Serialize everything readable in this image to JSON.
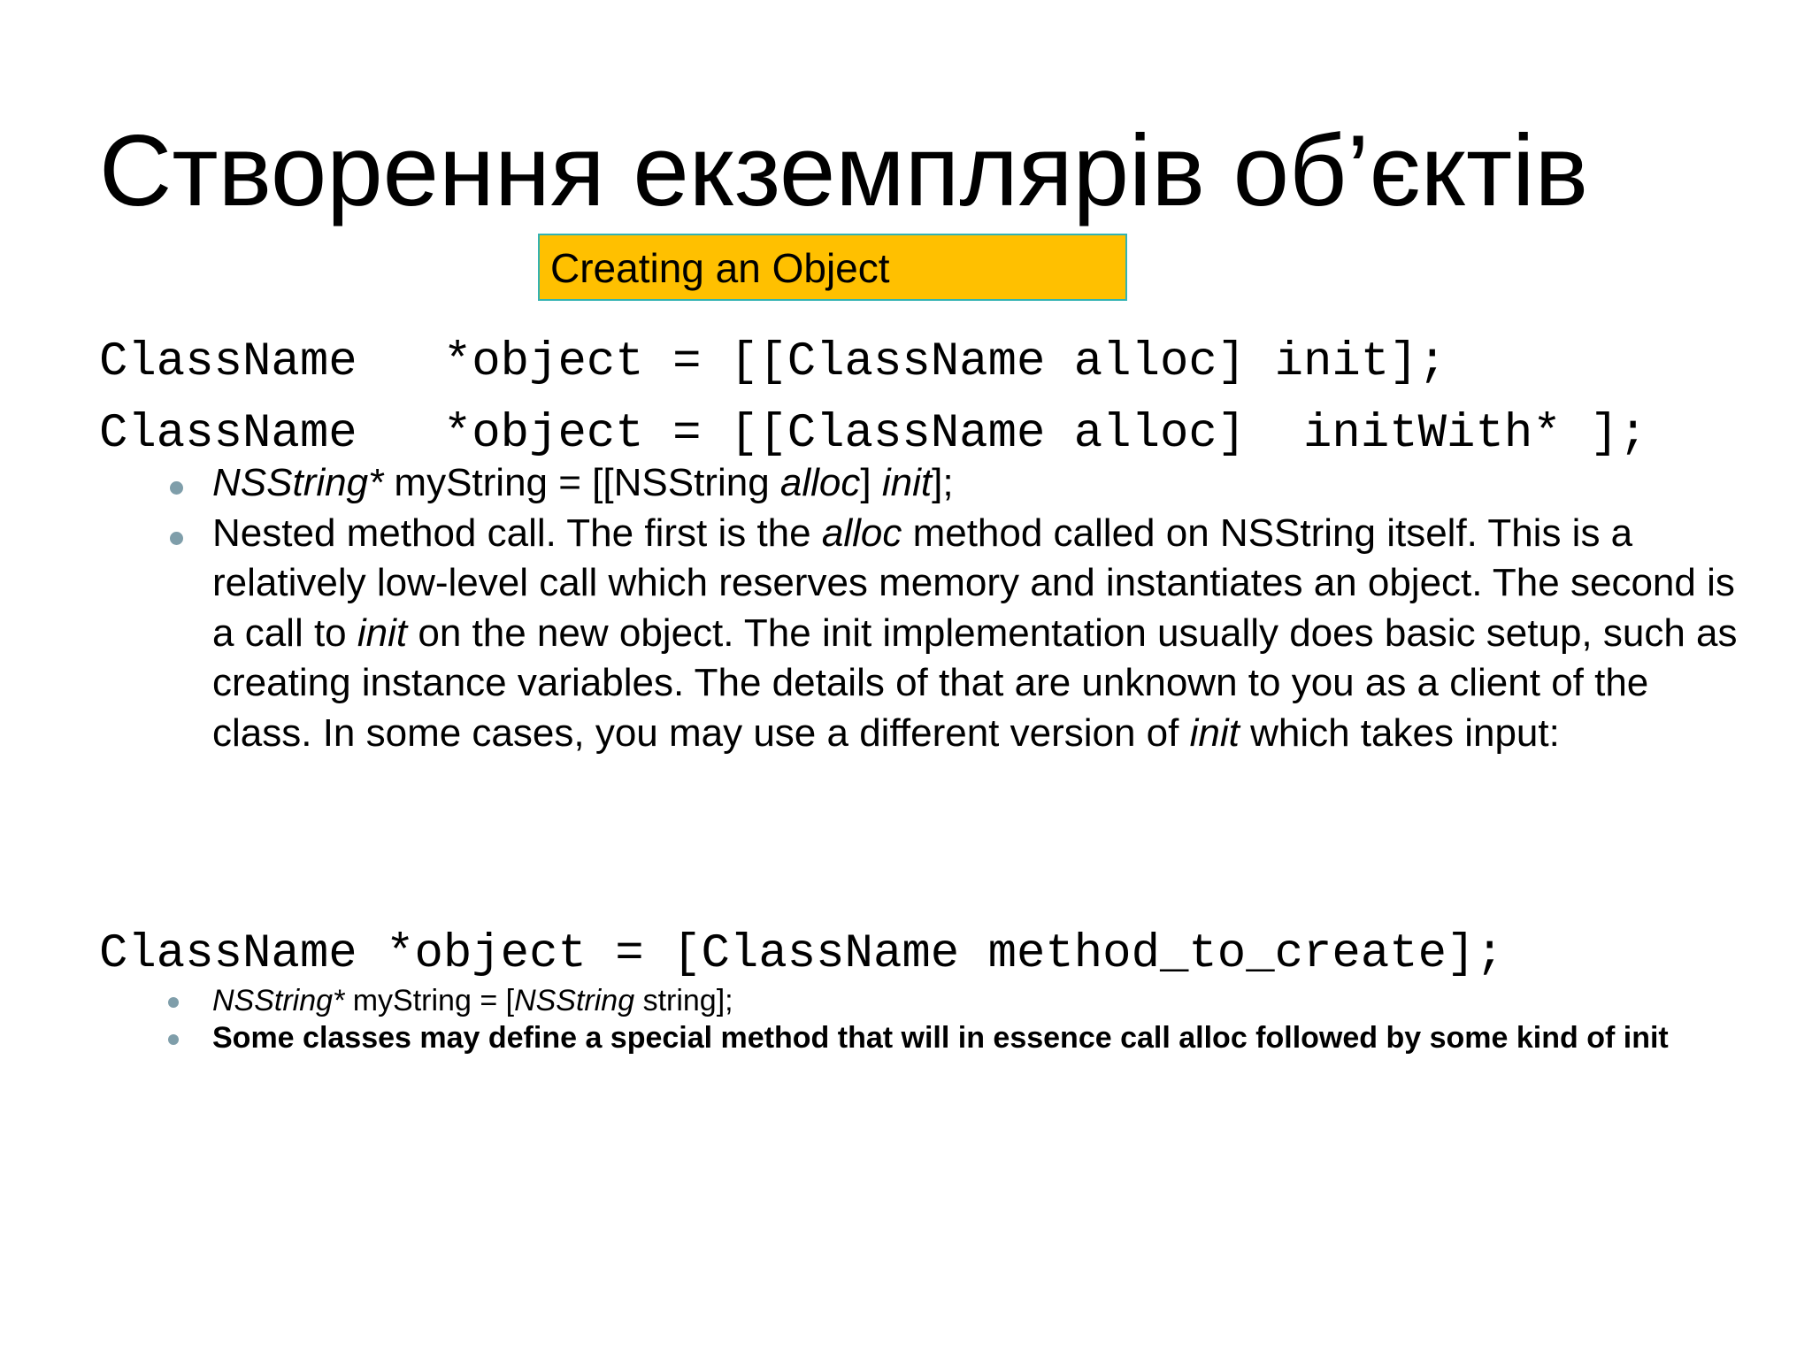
{
  "slide": {
    "title": "Створення екземплярів об’єктів",
    "highlight_label": "Creating an Object"
  },
  "code": {
    "line1": "ClassName   *object = [[ClassName alloc] init];",
    "line2": "ClassName   *object = [[ClassName alloc]  initWith* ];",
    "line3": "ClassName *object = [ClassName method_to_create];"
  },
  "bullets_first": {
    "b1": {
      "p1": "NSString*",
      "p2": " myString = [[NSString ",
      "p3": "alloc",
      "p4": "] ",
      "p5": "init",
      "p6": "];"
    },
    "b2": {
      "p1": "Nested method call. The first is the ",
      "p2": "alloc",
      "p3": " method called on NSString itself. This is a relatively low-level call which reserves memory and instantiates an object. The second is a call to ",
      "p4": "init",
      "p5": " on the new object. The init implementation usually does basic setup, such as creating instance variables. The details of that are unknown to you as a client of the class.  In some cases, you may use a different version of ",
      "p6": "init",
      "p7": " which takes input:"
    }
  },
  "bullets_second": {
    "b1": {
      "p1": "NSString*",
      "p2": " myString = [",
      "p3": "NSString",
      "p4": " string];"
    },
    "b2": "Some classes may define a special method that will in essence call alloc followed by some kind of init"
  },
  "colors": {
    "highlight_fill": "#ffc000",
    "highlight_border": "#33b3b3",
    "bullet": "#7f9eaa"
  }
}
